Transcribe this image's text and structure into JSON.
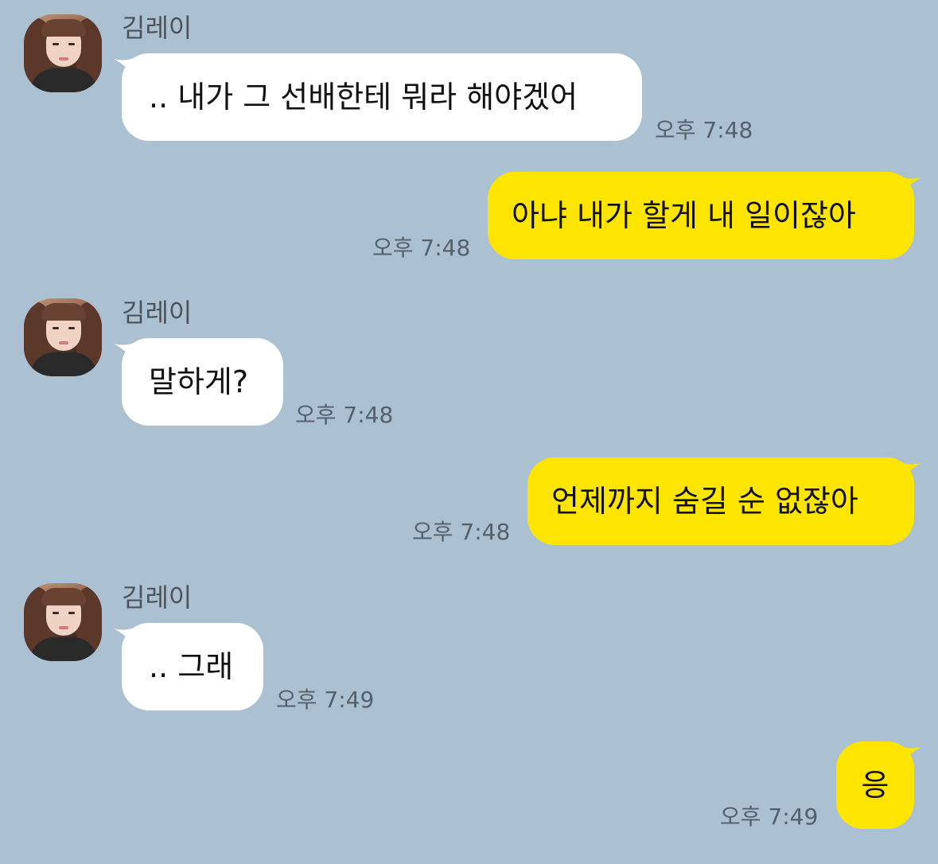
{
  "colors": {
    "background": "#abc1d1",
    "incoming_bubble": "#ffffff",
    "outgoing_bubble": "#fee500",
    "text": "#111111",
    "name": "#4b5259",
    "timestamp": "#55606a"
  },
  "messages": [
    {
      "direction": "in",
      "sender": "김레이",
      "text": ".. 내가 그 선배한테 뭐라 해야겠어",
      "time": "오후 7:48"
    },
    {
      "direction": "out",
      "text": "아냐 내가 할게 내 일이잖아",
      "time": "오후 7:48"
    },
    {
      "direction": "in",
      "sender": "김레이",
      "text": "말하게?",
      "time": "오후 7:48"
    },
    {
      "direction": "out",
      "text": "언제까지 숨길 순 없잖아",
      "time": "오후 7:48"
    },
    {
      "direction": "in",
      "sender": "김레이",
      "text": ".. 그래",
      "time": "오후 7:49"
    },
    {
      "direction": "out",
      "text": "응",
      "time": "오후 7:49"
    }
  ]
}
